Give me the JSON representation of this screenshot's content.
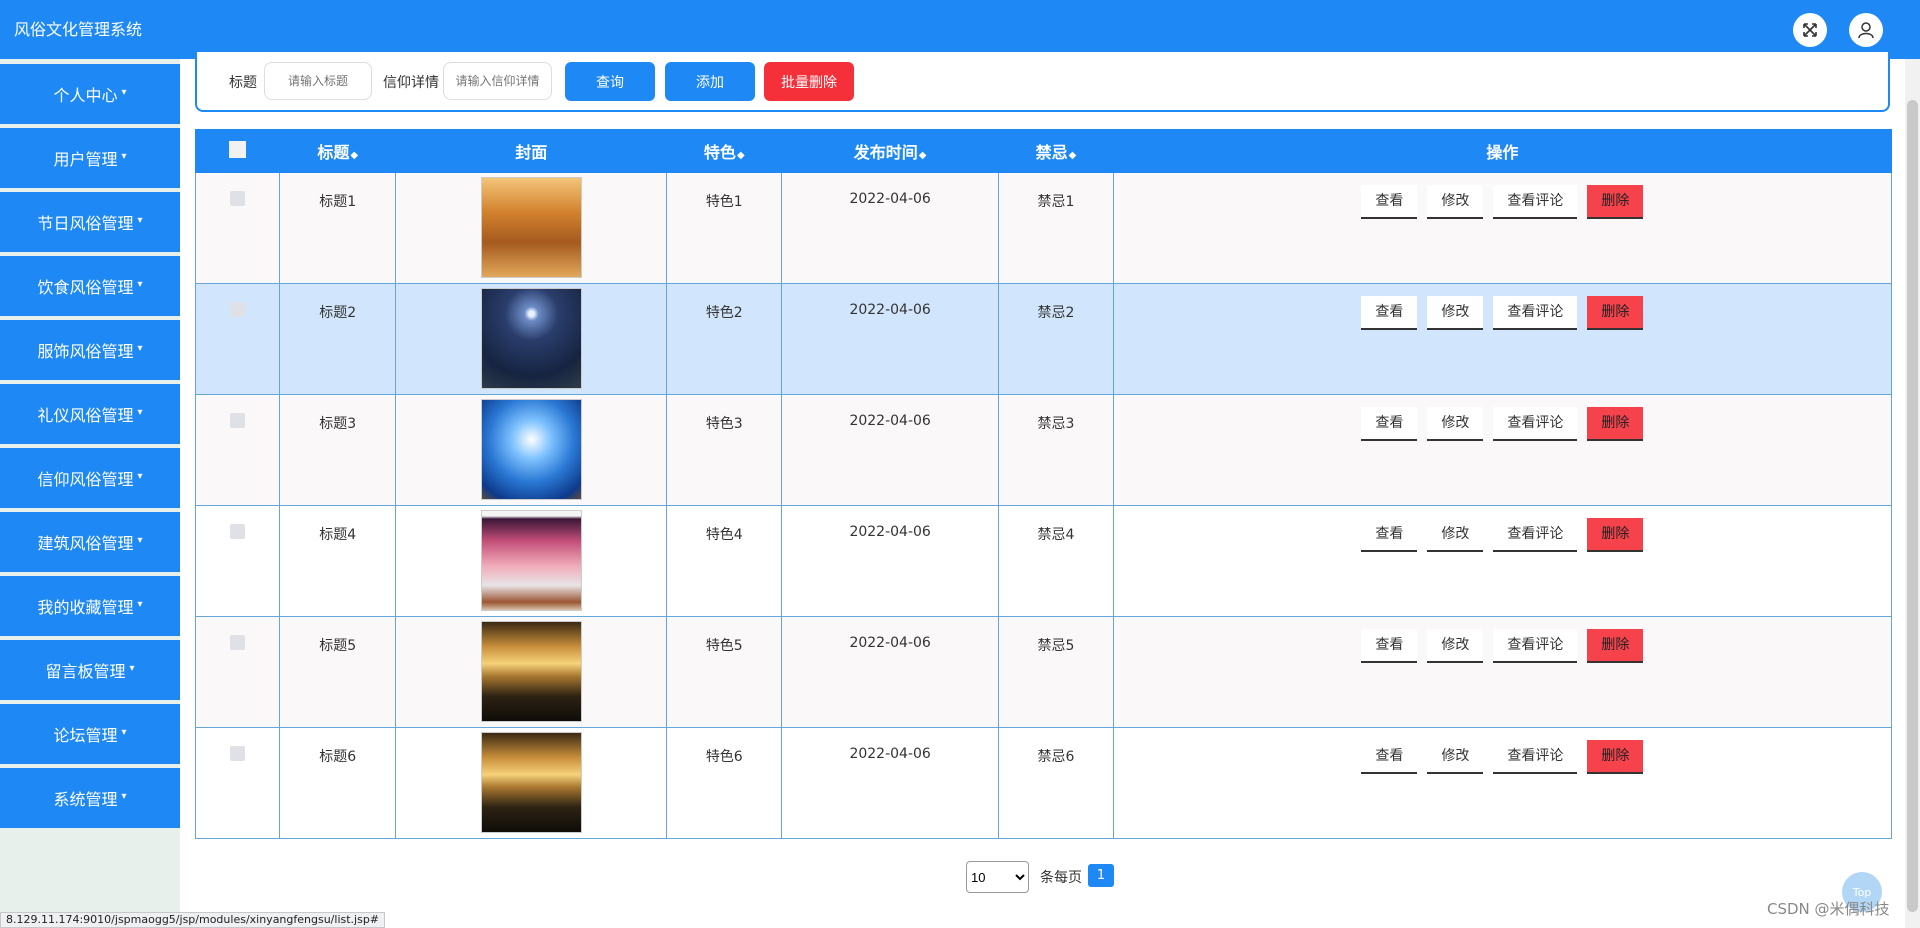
{
  "app": {
    "title": "风俗文化管理系统"
  },
  "header": {
    "fullscreen_icon": "fullscreen-icon",
    "user_icon": "user-icon"
  },
  "sidebar": {
    "items": [
      {
        "label": "个人中心"
      },
      {
        "label": "用户管理"
      },
      {
        "label": "节日风俗管理"
      },
      {
        "label": "饮食风俗管理"
      },
      {
        "label": "服饰风俗管理"
      },
      {
        "label": "礼仪风俗管理"
      },
      {
        "label": "信仰风俗管理"
      },
      {
        "label": "建筑风俗管理"
      },
      {
        "label": "我的收藏管理"
      },
      {
        "label": "留言板管理"
      },
      {
        "label": "论坛管理"
      },
      {
        "label": "系统管理"
      }
    ],
    "caret": "▾"
  },
  "search": {
    "title_label": "标题",
    "title_placeholder": "请输入标题",
    "detail_label": "信仰详情",
    "detail_placeholder": "请输入信仰详情",
    "query_button": "查询",
    "add_button": "添加",
    "batch_delete_button": "批量删除"
  },
  "table": {
    "columns": [
      "标题",
      "封面",
      "特色",
      "发布时间",
      "禁忌",
      "操作"
    ],
    "sort_mark": "◆",
    "rows": [
      {
        "title": "标题1",
        "feature": "特色1",
        "date": "2022-04-06",
        "taboo": "禁忌1",
        "cover": "autumn-forest"
      },
      {
        "title": "标题2",
        "feature": "特色2",
        "date": "2022-04-06",
        "taboo": "禁忌2",
        "cover": "night-sky"
      },
      {
        "title": "标题3",
        "feature": "特色3",
        "date": "2022-04-06",
        "taboo": "禁忌3",
        "cover": "blue-glow"
      },
      {
        "title": "标题4",
        "feature": "特色4",
        "date": "2022-04-06",
        "taboo": "禁忌4",
        "cover": "pink-painting"
      },
      {
        "title": "标题5",
        "feature": "特色5",
        "date": "2022-04-06",
        "taboo": "禁忌5",
        "cover": "sunset-beach"
      },
      {
        "title": "标题6",
        "feature": "特色6",
        "date": "2022-04-06",
        "taboo": "禁忌6",
        "cover": "sunset-beach"
      }
    ],
    "actions": {
      "view": "查看",
      "edit": "修改",
      "comments": "查看评论",
      "delete": "删除"
    }
  },
  "pagination": {
    "page_size": "10",
    "per_page_label": "条每页",
    "current_page": "1"
  },
  "status_bar": {
    "url": "8.129.11.174:9010/jspmaogg5/jsp/modules/xinyangfengsu/list.jsp#"
  },
  "watermark": "CSDN @米偶科技",
  "back_to_top": "Top",
  "colors": {
    "primary": "#1e88f5",
    "danger": "#f5424b",
    "highlight_row": "#d1e6fc"
  }
}
